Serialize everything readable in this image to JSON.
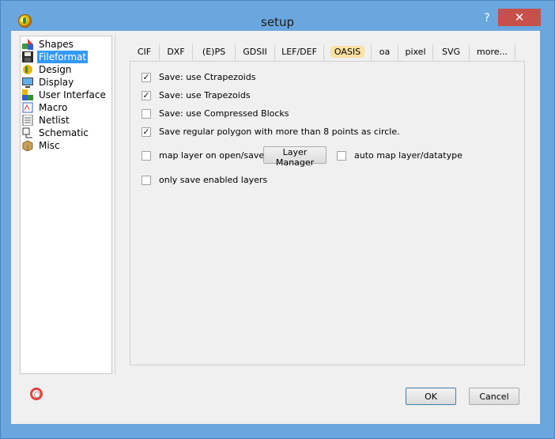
{
  "window": {
    "title": "setup",
    "help_glyph": "?",
    "close_glyph": "✕"
  },
  "nav": {
    "items": [
      {
        "label": "Shapes",
        "icon": "shapes-icon"
      },
      {
        "label": "Fileformat",
        "icon": "floppy-disk-icon",
        "selected": true
      },
      {
        "label": "Design",
        "icon": "design-icon"
      },
      {
        "label": "Display",
        "icon": "monitor-icon"
      },
      {
        "label": "User Interface",
        "icon": "user-interface-icon"
      },
      {
        "label": "Macro",
        "icon": "macro-icon"
      },
      {
        "label": "Netlist",
        "icon": "netlist-icon"
      },
      {
        "label": "Schematic",
        "icon": "schematic-icon"
      },
      {
        "label": "Misc",
        "icon": "box-icon"
      }
    ]
  },
  "tabs": {
    "items": [
      "CIF",
      "DXF",
      "(E)PS",
      "GDSII",
      "LEF/DEF",
      "OASIS",
      "oa",
      "pixel",
      "SVG",
      "more..."
    ],
    "active": "OASIS"
  },
  "options": {
    "ctrapezoids": {
      "label": "Save: use Ctrapezoids",
      "checked": true
    },
    "trapezoids": {
      "label": "Save: use Trapezoids",
      "checked": true
    },
    "compressed": {
      "label": "Save: use Compressed Blocks",
      "checked": false
    },
    "polygon_circle": {
      "label": "Save regular polygon with more than 8 points as circle.",
      "checked": true
    },
    "map_layer": {
      "label": "map layer on open/save",
      "checked": false
    },
    "layer_manager_label": "Layer Manager",
    "auto_map": {
      "label": "auto map layer/datatype",
      "checked": false
    },
    "only_enabled": {
      "label": "only save enabled layers",
      "checked": false
    }
  },
  "footer": {
    "ok_label": "OK",
    "cancel_label": "Cancel"
  },
  "colors": {
    "title_bar": "#6aa7df",
    "selection": "#3399ff",
    "active_tab": "#fbe1a2",
    "close_button": "#c7504a"
  }
}
